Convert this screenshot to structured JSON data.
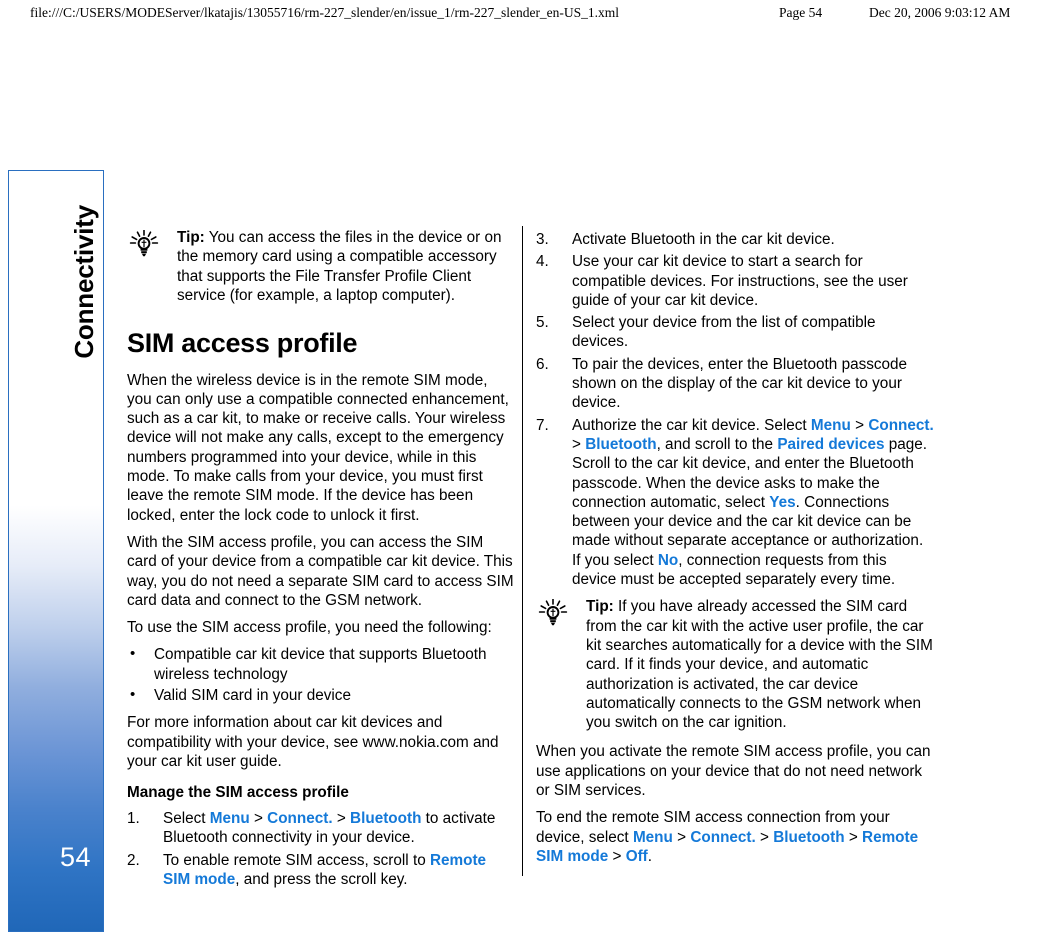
{
  "print_header": {
    "url": "file:///C:/USERS/MODEServer/lkatajis/13055716/rm-227_slender/en/issue_1/rm-227_slender_en-US_1.xml",
    "page_label": "Page 54",
    "timestamp": "Dec 20, 2006 9:03:12 AM"
  },
  "chapter_tab": {
    "label": "Connectivity",
    "page_number": "54",
    "border_color": "#2a6fc0",
    "gradient_end_color": "#2067b8",
    "page_number_color": "#ffffff"
  },
  "colors": {
    "ui_link": "#1479d8",
    "text": "#000000",
    "background": "#ffffff"
  },
  "left_column": {
    "tip": {
      "icon": "lightbulb-icon",
      "label": "Tip:",
      "text": " You can access the files in the device or on the memory card using a compatible accessory that supports the File Transfer Profile Client service (for example, a laptop computer)."
    },
    "section_title": "SIM access profile",
    "paragraph_1": "When the wireless device is in the remote SIM mode, you can only use a compatible connected enhancement, such as a car kit, to make or receive calls. Your wireless device will not make any calls, except to the emergency numbers programmed into your device, while in this mode. To make calls from your device, you must first leave the remote SIM mode. If the device has been locked, enter the lock code to unlock it first.",
    "paragraph_2": "With the SIM access profile, you can access the SIM card of your device from a compatible car kit device. This way, you do not need a separate SIM card to access SIM card data and connect to the GSM network.",
    "paragraph_3": "To use the SIM access profile, you need the following:",
    "bullets": [
      "Compatible car kit device that supports Bluetooth wireless technology",
      "Valid SIM card in your device"
    ],
    "paragraph_4": "For more information about car kit devices and compatibility with your device, see www.nokia.com and your car kit user guide.",
    "sub_title": "Manage the SIM access profile",
    "steps": [
      {
        "num": "1.",
        "parts": [
          {
            "t": "Select ",
            "ui": false
          },
          {
            "t": "Menu",
            "ui": true
          },
          {
            "t": " > ",
            "ui": false
          },
          {
            "t": "Connect.",
            "ui": true
          },
          {
            "t": " > ",
            "ui": false
          },
          {
            "t": "Bluetooth",
            "ui": true
          },
          {
            "t": " to activate Bluetooth connectivity in your device.",
            "ui": false
          }
        ]
      },
      {
        "num": "2.",
        "parts": [
          {
            "t": "To enable remote SIM access, scroll to ",
            "ui": false
          },
          {
            "t": "Remote SIM mode",
            "ui": true
          },
          {
            "t": ", and press the scroll key.",
            "ui": false
          }
        ]
      }
    ]
  },
  "right_column": {
    "steps": [
      {
        "num": "3.",
        "parts": [
          {
            "t": "Activate Bluetooth in the car kit device.",
            "ui": false
          }
        ]
      },
      {
        "num": "4.",
        "parts": [
          {
            "t": "Use your car kit device to start a search for compatible devices. For instructions, see the user guide of your car kit device.",
            "ui": false
          }
        ]
      },
      {
        "num": "5.",
        "parts": [
          {
            "t": "Select your device from the list of compatible devices.",
            "ui": false
          }
        ]
      },
      {
        "num": "6.",
        "parts": [
          {
            "t": "To pair the devices, enter the Bluetooth passcode shown on the display of the car kit device to your device.",
            "ui": false
          }
        ]
      },
      {
        "num": "7.",
        "parts": [
          {
            "t": "Authorize the car kit device. Select ",
            "ui": false
          },
          {
            "t": "Menu",
            "ui": true
          },
          {
            "t": " > ",
            "ui": false
          },
          {
            "t": "Connect.",
            "ui": true
          },
          {
            "t": " > ",
            "ui": false
          },
          {
            "t": "Bluetooth",
            "ui": true
          },
          {
            "t": ", and scroll to the ",
            "ui": false
          },
          {
            "t": "Paired devices",
            "ui": true
          },
          {
            "t": " page. Scroll to the car kit device, and enter the Bluetooth passcode. When the device asks to make the connection automatic, select ",
            "ui": false
          },
          {
            "t": "Yes",
            "ui": true
          },
          {
            "t": ". Connections between your device and the car kit device can be made without separate acceptance or authorization. If you select ",
            "ui": false
          },
          {
            "t": "No",
            "ui": true
          },
          {
            "t": ", connection requests from this device must be accepted separately every time.",
            "ui": false
          }
        ]
      }
    ],
    "tip": {
      "icon": "lightbulb-icon",
      "label": "Tip:",
      "text": " If you have already accessed the SIM card from the car kit with the active user profile, the car kit searches automatically for a device with the SIM card. If it finds your device, and automatic authorization is activated, the car device automatically connects to the GSM network when you switch on the car ignition."
    },
    "paragraph_1": "When you activate the remote SIM access profile, you can use applications on your device that do not need network or SIM services.",
    "paragraph_2_parts": [
      {
        "t": "To end the remote SIM access connection from your device, select ",
        "ui": false
      },
      {
        "t": "Menu",
        "ui": true
      },
      {
        "t": " > ",
        "ui": false
      },
      {
        "t": "Connect.",
        "ui": true
      },
      {
        "t": " > ",
        "ui": false
      },
      {
        "t": "Bluetooth",
        "ui": true
      },
      {
        "t": " > ",
        "ui": false
      },
      {
        "t": "Remote SIM mode",
        "ui": true
      },
      {
        "t": " > ",
        "ui": false
      },
      {
        "t": "Off",
        "ui": true
      },
      {
        "t": ".",
        "ui": false
      }
    ]
  }
}
